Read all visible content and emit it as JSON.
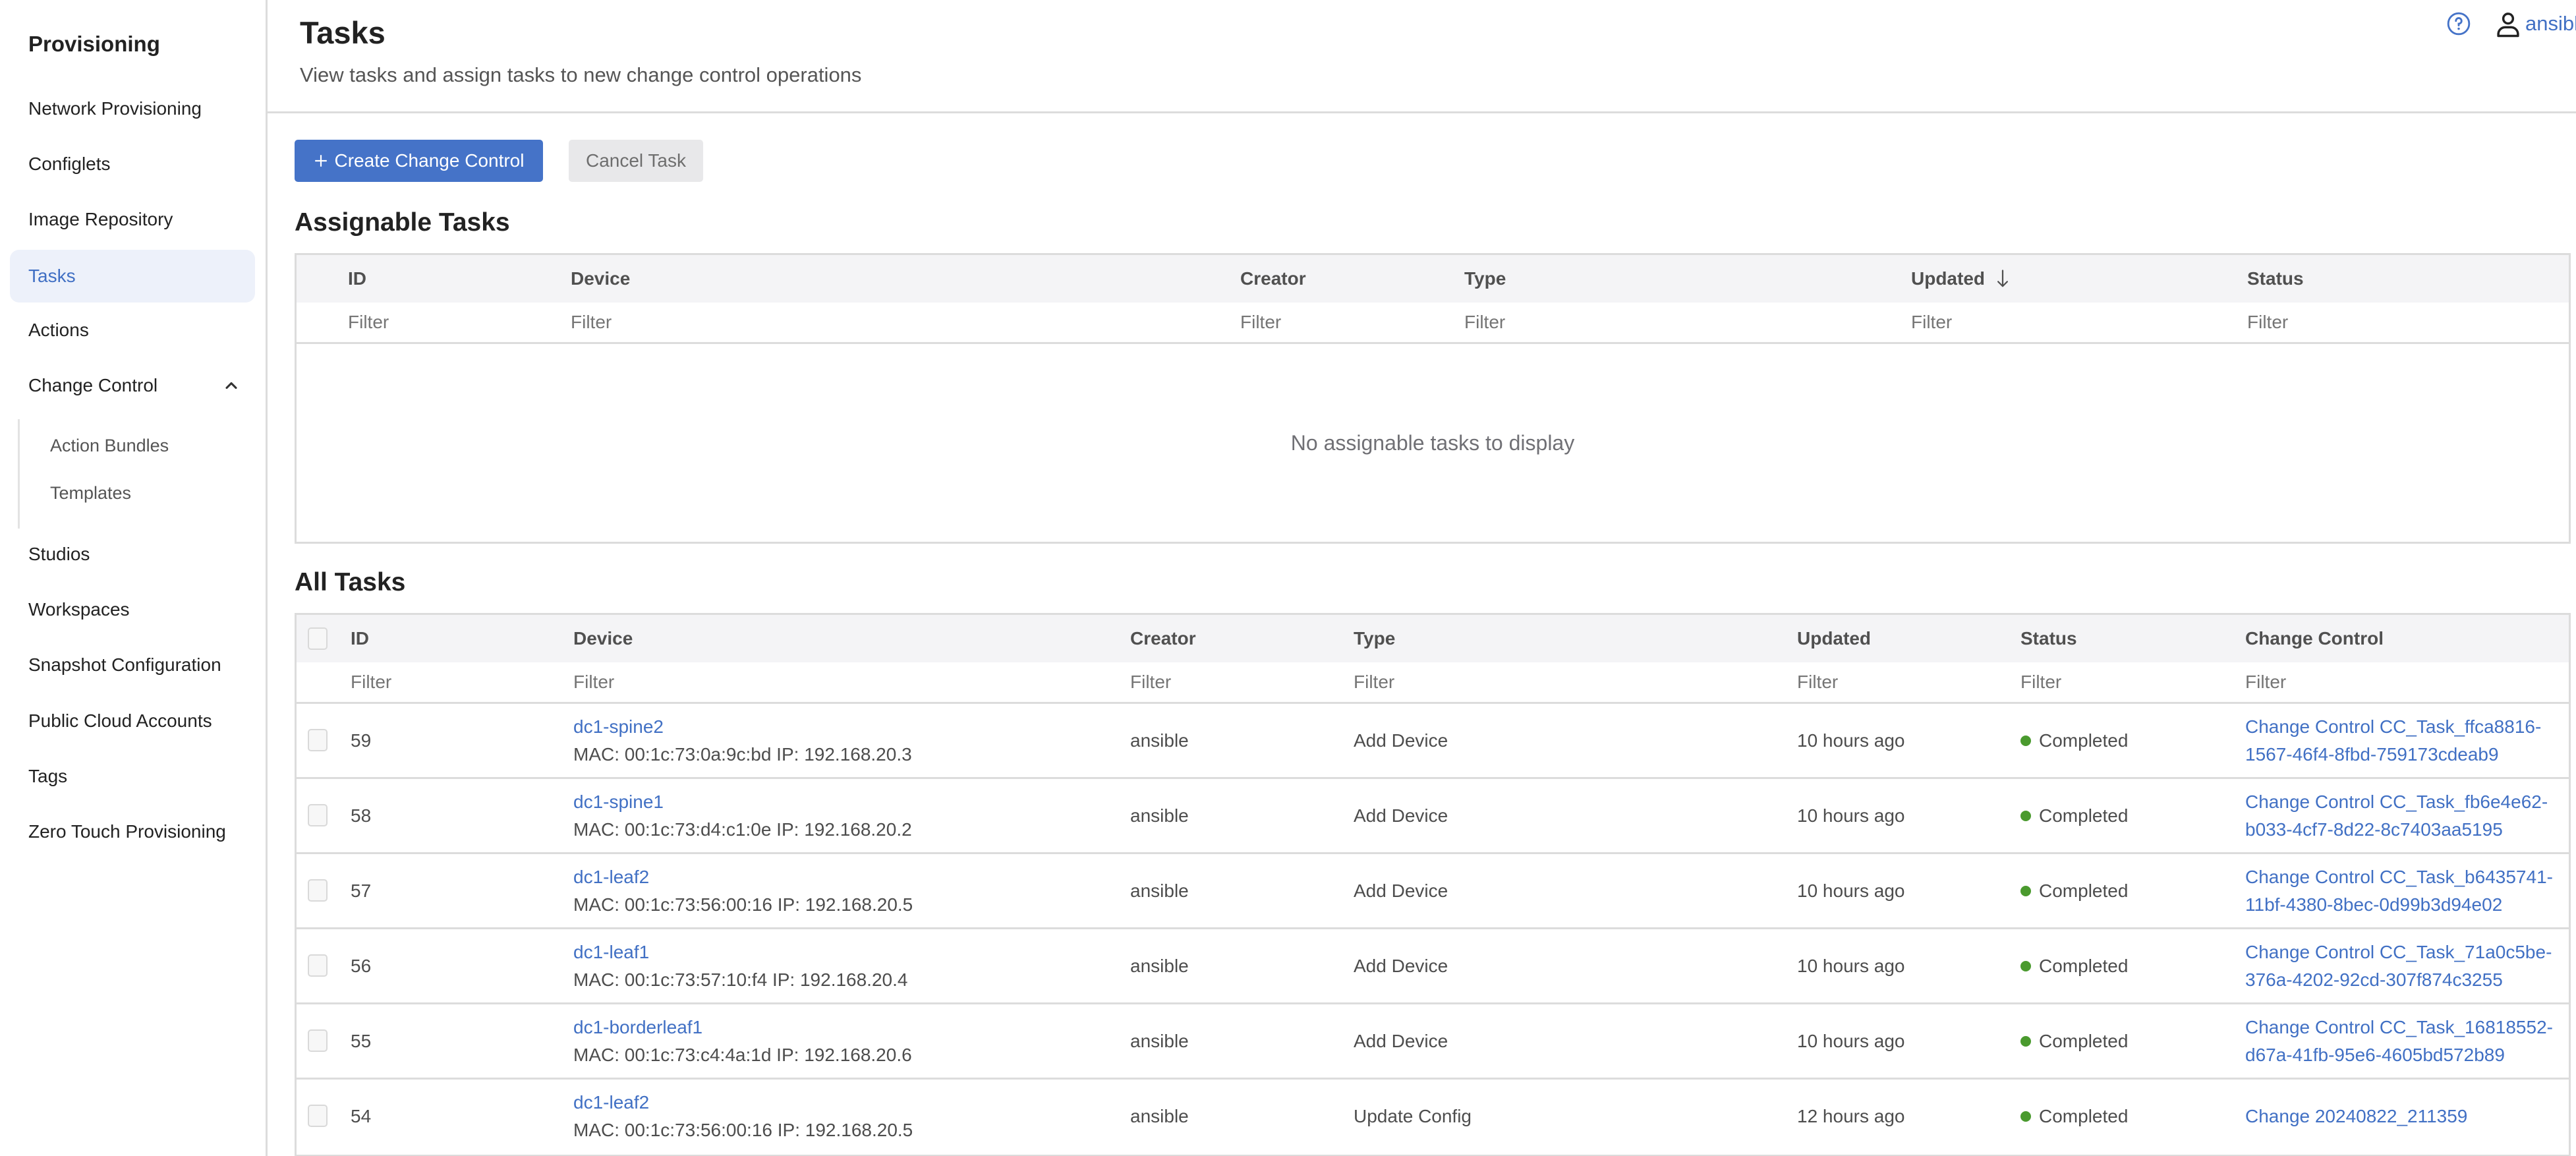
{
  "sidebar": {
    "title": "Provisioning",
    "items": [
      {
        "label": "Network Provisioning"
      },
      {
        "label": "Configlets"
      },
      {
        "label": "Image Repository"
      },
      {
        "label": "Tasks",
        "active": true
      },
      {
        "label": "Actions"
      },
      {
        "label": "Change Control",
        "expanded": true
      },
      {
        "label": "Studios"
      },
      {
        "label": "Workspaces"
      },
      {
        "label": "Snapshot Configuration"
      },
      {
        "label": "Public Cloud Accounts"
      },
      {
        "label": "Tags"
      },
      {
        "label": "Zero Touch Provisioning"
      }
    ],
    "change_control_children": [
      {
        "label": "Action Bundles"
      },
      {
        "label": "Templates"
      }
    ]
  },
  "header": {
    "title": "Tasks",
    "subtitle": "View tasks and assign tasks to new change control operations",
    "help_icon": "help-circle-icon",
    "user_icon": "user-icon",
    "username": "ansibl"
  },
  "toolbar": {
    "create_label": "Create Change Control",
    "cancel_label": "Cancel Task"
  },
  "assignable": {
    "title": "Assignable Tasks",
    "columns": [
      "ID",
      "Device",
      "Creator",
      "Type",
      "Updated",
      "Status"
    ],
    "sorted_column": "Updated",
    "sort_direction": "descending",
    "filter_placeholder": "Filter",
    "empty_message": "No assignable tasks to display"
  },
  "all_tasks": {
    "title": "All Tasks",
    "columns": [
      "ID",
      "Device",
      "Creator",
      "Type",
      "Updated",
      "Status",
      "Change Control"
    ],
    "filter_placeholder": "Filter",
    "rows": [
      {
        "id": "59",
        "device": "dc1-spine2",
        "meta": "MAC: 00:1c:73:0a:9c:bd IP: 192.168.20.3",
        "creator": "ansible",
        "type": "Add Device",
        "updated": "10 hours ago",
        "status": "Completed",
        "change_control": "Change Control CC_Task_ffca8816-1567-46f4-8fbd-759173cdeab9"
      },
      {
        "id": "58",
        "device": "dc1-spine1",
        "meta": "MAC: 00:1c:73:d4:c1:0e IP: 192.168.20.2",
        "creator": "ansible",
        "type": "Add Device",
        "updated": "10 hours ago",
        "status": "Completed",
        "change_control": "Change Control CC_Task_fb6e4e62-b033-4cf7-8d22-8c7403aa5195"
      },
      {
        "id": "57",
        "device": "dc1-leaf2",
        "meta": "MAC: 00:1c:73:56:00:16 IP: 192.168.20.5",
        "creator": "ansible",
        "type": "Add Device",
        "updated": "10 hours ago",
        "status": "Completed",
        "change_control": "Change Control CC_Task_b6435741-11bf-4380-8bec-0d99b3d94e02"
      },
      {
        "id": "56",
        "device": "dc1-leaf1",
        "meta": "MAC: 00:1c:73:57:10:f4 IP: 192.168.20.4",
        "creator": "ansible",
        "type": "Add Device",
        "updated": "10 hours ago",
        "status": "Completed",
        "change_control": "Change Control CC_Task_71a0c5be-376a-4202-92cd-307f874c3255"
      },
      {
        "id": "55",
        "device": "dc1-borderleaf1",
        "meta": "MAC: 00:1c:73:c4:4a:1d IP: 192.168.20.6",
        "creator": "ansible",
        "type": "Add Device",
        "updated": "10 hours ago",
        "status": "Completed",
        "change_control": "Change Control CC_Task_16818552-d67a-41fb-95e6-4605bd572b89"
      },
      {
        "id": "54",
        "device": "dc1-leaf2",
        "meta": "MAC: 00:1c:73:56:00:16 IP: 192.168.20.5",
        "creator": "ansible",
        "type": "Update Config",
        "updated": "12 hours ago",
        "status": "Completed",
        "change_control": "Change 20240822_211359"
      }
    ]
  },
  "colors": {
    "accent": "#4573c8",
    "link": "#4170c4",
    "status_completed": "#4a9a2e",
    "active_nav_bg": "#edf1fa"
  }
}
